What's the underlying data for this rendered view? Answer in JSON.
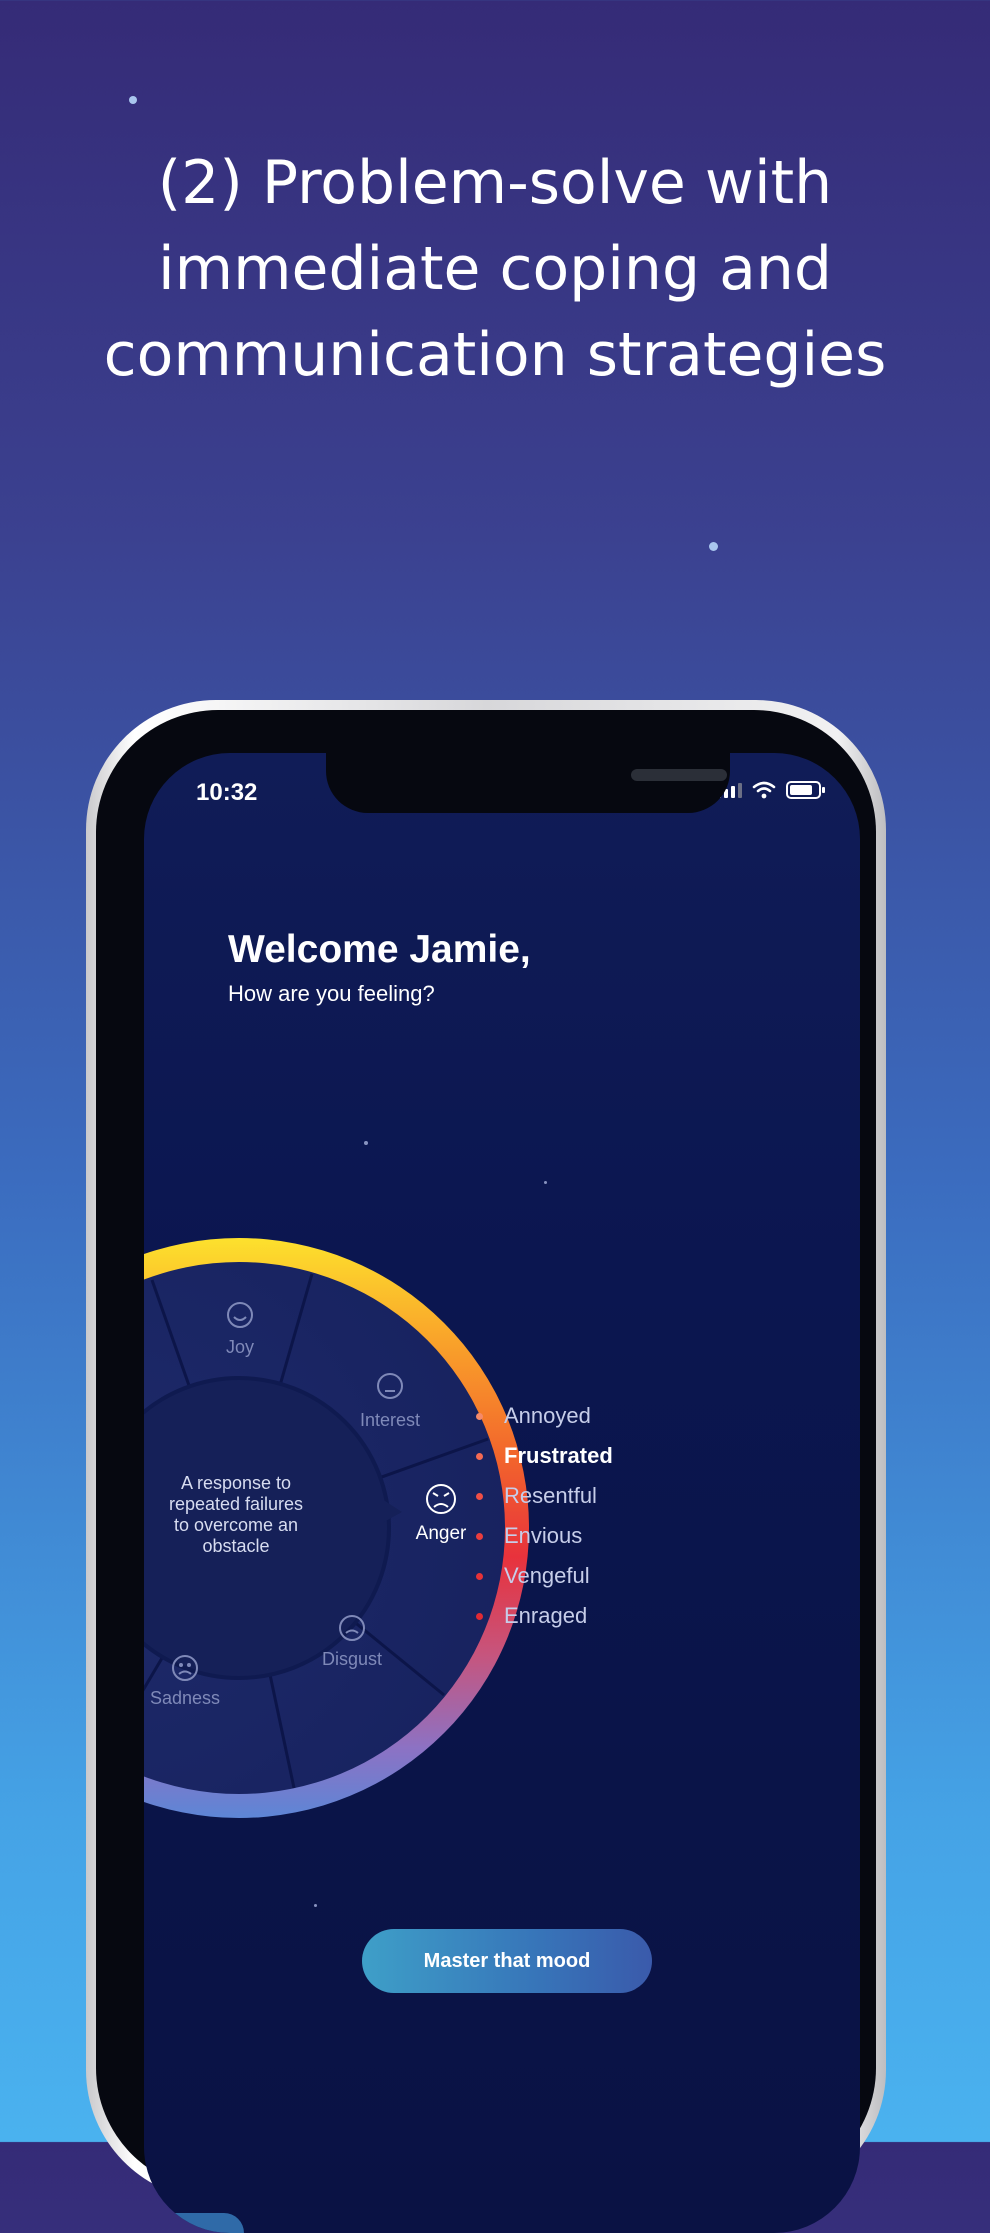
{
  "headline": {
    "lines": [
      "(2) Problem-solve with",
      "immediate coping and",
      "communication strategies"
    ]
  },
  "status_bar": {
    "time": "10:32",
    "icons": [
      "cellular-signal-icon",
      "wifi-icon",
      "battery-icon"
    ]
  },
  "greeting": {
    "title": "Welcome Jamie,",
    "subtitle": "How are you feeling?"
  },
  "wheel": {
    "center_text": [
      "A response to",
      "repeated failures",
      "to overcome an",
      "obstacle"
    ],
    "segments": [
      {
        "label": "Joy",
        "icon": "smile-face-icon",
        "selected": false
      },
      {
        "label": "Interest",
        "icon": "neutral-face-icon",
        "selected": false
      },
      {
        "label": "Anger",
        "icon": "angry-face-icon",
        "selected": true
      },
      {
        "label": "Disgust",
        "icon": "frown-face-icon",
        "selected": false
      },
      {
        "label": "Sadness",
        "icon": "sad-face-icon",
        "selected": false
      }
    ],
    "ring_colors": [
      "#fde12d",
      "#f9a22a",
      "#f2642c",
      "#e8323c",
      "#c6557e",
      "#8c72c4",
      "#5d86d6"
    ]
  },
  "emotion_options": [
    {
      "label": "Annoyed",
      "color": "#f58a6a",
      "selected": false
    },
    {
      "label": "Frustrated",
      "color": "#f46a53",
      "selected": true
    },
    {
      "label": "Resentful",
      "color": "#ef4f46",
      "selected": false
    },
    {
      "label": "Envious",
      "color": "#ea3d3e",
      "selected": false
    },
    {
      "label": "Vengeful",
      "color": "#e63238",
      "selected": false
    },
    {
      "label": "Enraged",
      "color": "#e02a34",
      "selected": false
    }
  ],
  "cta": {
    "label": "Master that mood"
  },
  "colors": {
    "accent": "#3e9fc8",
    "background_top": "#352b77",
    "background_bottom": "#4ab2ef"
  }
}
